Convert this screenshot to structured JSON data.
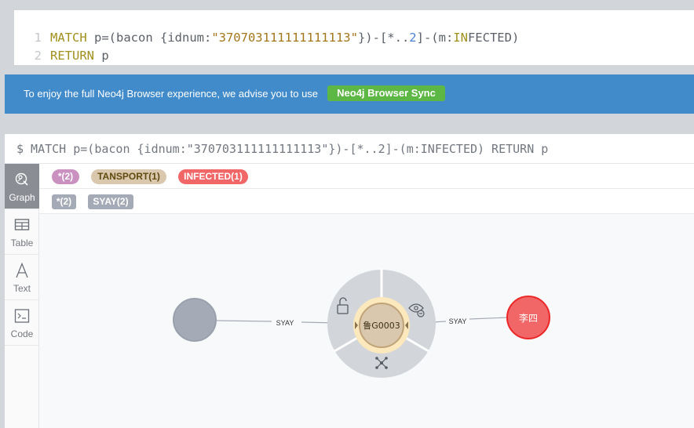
{
  "editor": {
    "line1": {
      "num": "1",
      "kw1": "MATCH",
      "p1": " p=(bacon {idnum:",
      "str": "\"370703111111111113\"",
      "p2": "})-[*..",
      "n": "2",
      "p3": "]-(m:",
      "kw2": "IN",
      "p4": "FECTED)"
    },
    "line2": {
      "num": "2",
      "kw": "RETURN",
      "rest": " p"
    }
  },
  "banner": {
    "text": "To enjoy the full Neo4j Browser experience, we advise you to use",
    "button": "Neo4j Browser Sync"
  },
  "frame": {
    "query": "$ MATCH p=(bacon {idnum:\"370703111111111113\"})-[*..2]-(m:INFECTED) RETURN p"
  },
  "sidebar": {
    "graph": "Graph",
    "table": "Table",
    "text": "Text",
    "code": "Code"
  },
  "legend": {
    "labels": [
      {
        "text": "*(2)",
        "bg": "#c990c0",
        "color": "#ffffff"
      },
      {
        "text": "TANSPORT(1)",
        "bg": "#d9c8ae",
        "color": "#604a0e"
      },
      {
        "text": "INFECTED(1)",
        "bg": "#f16667",
        "color": "#ffffff"
      }
    ],
    "rels": [
      {
        "text": "*(2)"
      },
      {
        "text": "SYAY(2)"
      }
    ]
  },
  "graph": {
    "nodes": {
      "gray": {
        "caption": "",
        "color": "#a5abb6"
      },
      "center": {
        "caption": "鲁G0003",
        "color": "#d9c8ae"
      },
      "red": {
        "caption": "李四",
        "color": "#f16667"
      }
    },
    "edges": {
      "left": "SYAY",
      "right": "SYAY"
    }
  }
}
